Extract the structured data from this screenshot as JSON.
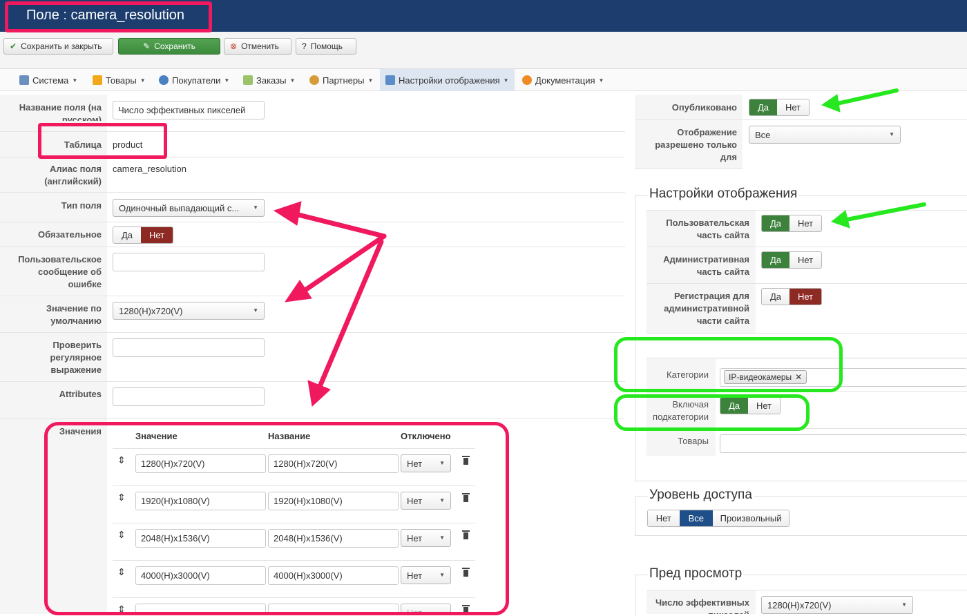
{
  "header": {
    "title": "Поле : camera_resolution"
  },
  "toolbar": {
    "save_close": "Сохранить и закрыть",
    "save": "Сохранить",
    "cancel": "Отменить",
    "help": "Помощь"
  },
  "menu": {
    "items": [
      "Система",
      "Товары",
      "Покупатели",
      "Заказы",
      "Партнеры",
      "Настройки отображения",
      "Документация"
    ]
  },
  "left": {
    "name_ru_label": "Название поля (на русском)",
    "name_ru_value": "Число эффективных пикселей",
    "table_label": "Таблица",
    "table_value": "product",
    "alias_label": "Алиас поля (английский)",
    "alias_value": "camera_resolution",
    "type_label": "Тип поля",
    "type_value": "Одиночный выпадающий с...",
    "required_label": "Обязательное",
    "yes": "Да",
    "no": "Нет",
    "error_msg_label": "Пользовательское сообщение об ошибке",
    "default_label": "Значение по умолчанию",
    "default_value": "1280(H)x720(V)",
    "regex_label": "Проверить регулярное выражение",
    "attributes_label": "Attributes",
    "values_label": "Значения",
    "values_table": {
      "headers": [
        "Значение",
        "Название",
        "Отключено"
      ],
      "rows": [
        {
          "value": "1280(H)x720(V)",
          "name": "1280(H)x720(V)",
          "disabled": "Нет"
        },
        {
          "value": "1920(H)x1080(V)",
          "name": "1920(H)x1080(V)",
          "disabled": "Нет"
        },
        {
          "value": "2048(H)x1536(V)",
          "name": "2048(H)x1536(V)",
          "disabled": "Нет"
        },
        {
          "value": "4000(H)x3000(V)",
          "name": "4000(H)x3000(V)",
          "disabled": "Нет"
        },
        {
          "value": "",
          "name": "",
          "disabled": "Нет"
        }
      ]
    }
  },
  "right": {
    "published_label": "Опубликовано",
    "access_only_label": "Отображение разрешено только для",
    "access_only_value": "Все",
    "display_settings_title": "Настройки отображения",
    "site_label": "Пользовательская часть сайта",
    "admin_label": "Административная часть сайта",
    "admin_reg_label": "Регистрация для административной части сайта",
    "categories_label": "Категории",
    "category_tag": "IP-видеокамеры",
    "subcats_label": "Включая подкатегории",
    "products_label": "Товары",
    "access_level_title": "Уровень доступа",
    "access_options": [
      "Нет",
      "Все",
      "Произвольный"
    ],
    "preview_title": "Пред просмотр",
    "preview_label": "Число эффективных пикселей",
    "preview_value": "1280(H)x720(V)"
  },
  "colors": {
    "header_bg": "#1c3d6e",
    "active_green": "#3c823c",
    "active_red": "#8d2a23",
    "active_blue": "#1f4f88",
    "annotation_pink": "#f0195e",
    "annotation_green": "#26e81f"
  }
}
